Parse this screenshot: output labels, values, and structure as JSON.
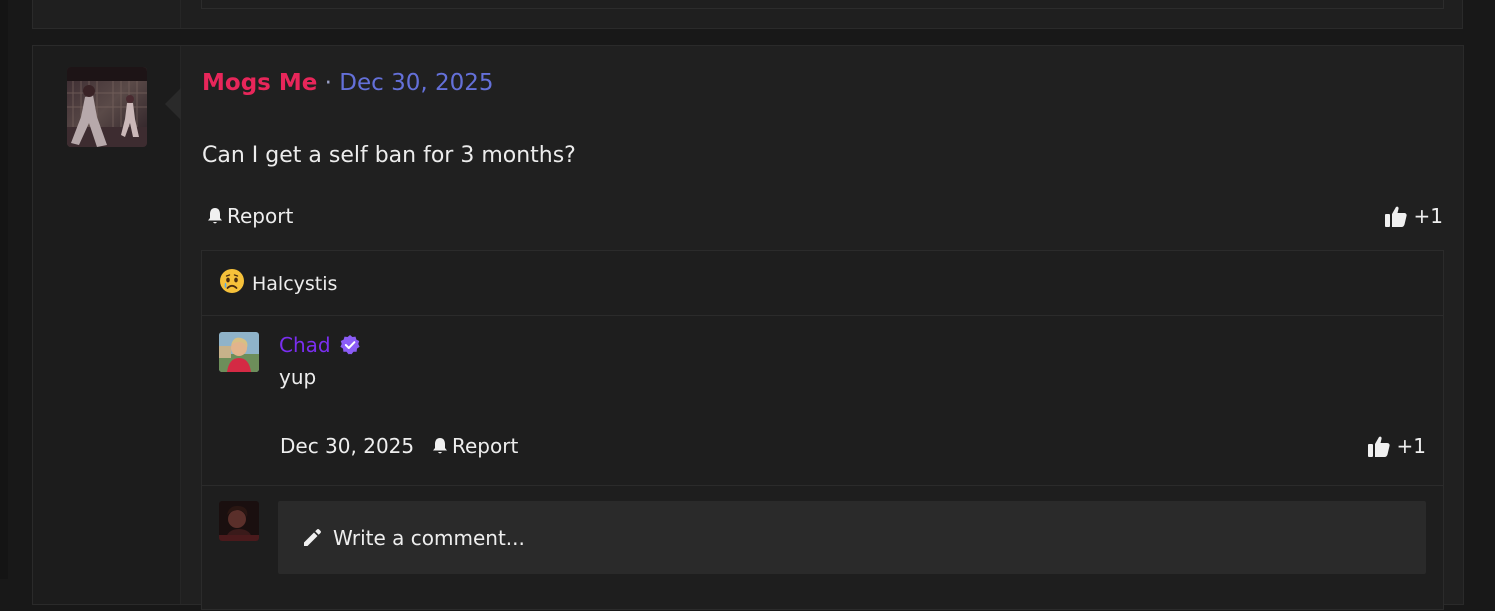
{
  "post": {
    "author": "Mogs Me",
    "separator": "·",
    "date": "Dec 30, 2025",
    "body": "Can I get a self ban for 3 months?",
    "report_label": "Report",
    "like_count": "+1"
  },
  "reactions": {
    "emoji": "sad-face-icon",
    "user": "Halcystis"
  },
  "comment": {
    "author": "Chad",
    "verified": true,
    "text": "yup",
    "date": "Dec 30, 2025",
    "report_label": "Report",
    "like_count": "+1"
  },
  "composer": {
    "placeholder": "Write a comment..."
  },
  "colors": {
    "author": "#e8265a",
    "date": "#6470d9",
    "comment_author": "#7a2ef0",
    "verified_badge": "#8b5cf6"
  }
}
